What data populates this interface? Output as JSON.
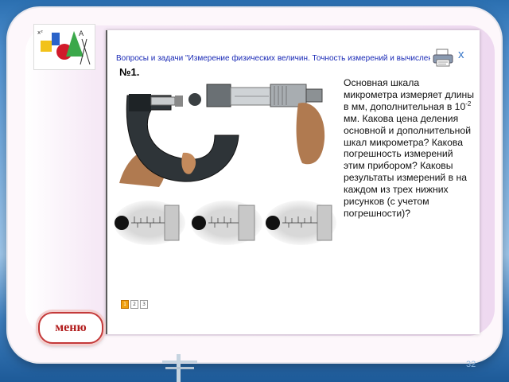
{
  "header": {
    "title": "Вопросы и задачи \"Измерение физических величин. Точность измерений и вычислений.\"",
    "close_symbol": "x"
  },
  "problem": {
    "number": "№1.",
    "question_before_exp": "Основная шкала микрометра измеряет длины в мм, дополнительная в 10",
    "exponent": "-2",
    "question_after_exp": " мм. Какова цена деления основной и дополнительной шкал микрометра? Какова погрешность измерений этим прибором? Каковы результаты измерений в на каждом из трех нижних рисунков (с учетом погрешности)?"
  },
  "pager": {
    "pages": [
      "1",
      "2",
      "3"
    ],
    "active_index": 0
  },
  "menu": {
    "label": "меню"
  },
  "footer": {
    "slide_number": "32"
  },
  "colors": {
    "title_blue": "#1b2bb6",
    "menu_red": "#b21d1d",
    "pager_active": "#f0a010"
  },
  "icons": [
    "logo-image",
    "printer-icon",
    "close-icon"
  ]
}
